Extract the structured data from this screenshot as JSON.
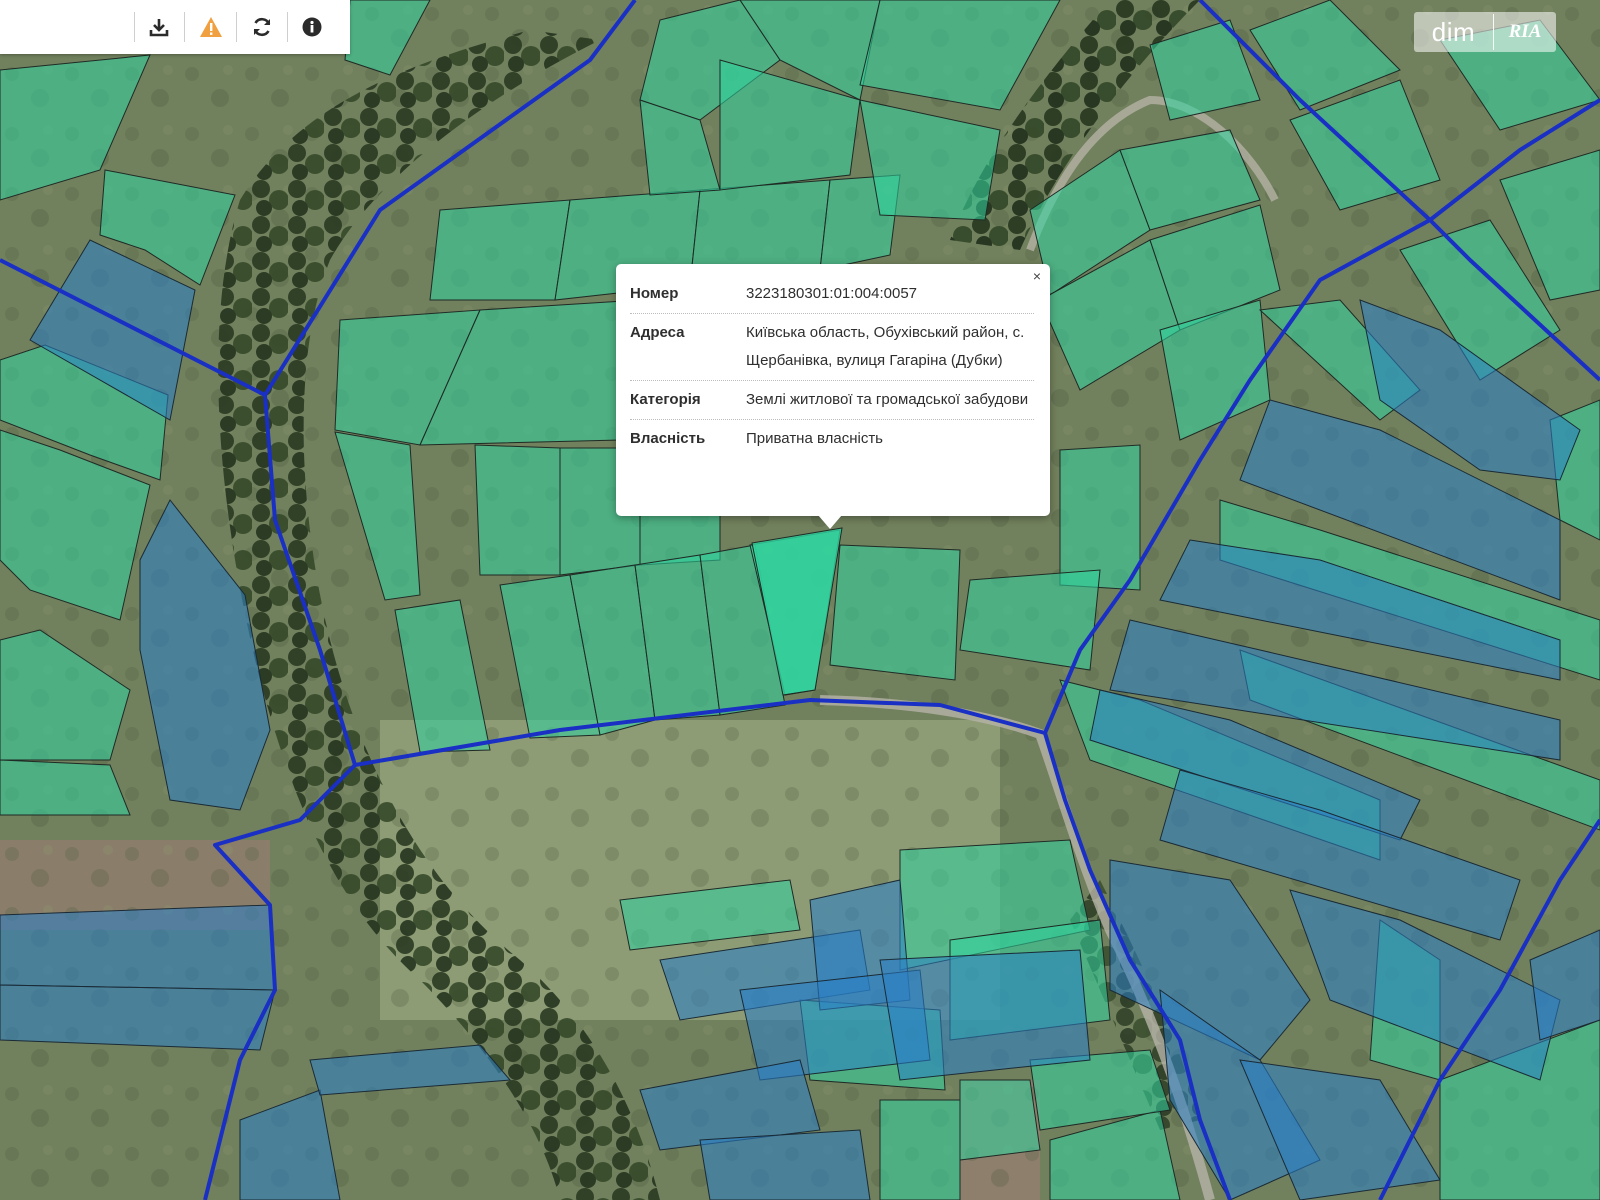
{
  "toolbar": {
    "buttons": [
      {
        "name": "download-icon"
      },
      {
        "name": "warning-icon"
      },
      {
        "name": "refresh-icon"
      },
      {
        "name": "info-icon"
      }
    ]
  },
  "watermark": {
    "left": "dim",
    "right": "RIA"
  },
  "popup": {
    "close": "×",
    "rows": [
      {
        "label": "Номер",
        "value": "3223180301:01:004:0057"
      },
      {
        "label": "Адреса",
        "value": "Київська область, Обухівський район, с. Щербанівка, вулиця Гагаріна (Дубки)"
      },
      {
        "label": "Категорія",
        "value": "Землі житлової та громадської забудови"
      },
      {
        "label": "Власність",
        "value": "Приватна власність"
      }
    ]
  },
  "colors": {
    "parcel_green": "#2fd6a0",
    "parcel_blue": "#2a7fc9",
    "boundary": "#1a2fc4",
    "warning": "#f0a040"
  }
}
